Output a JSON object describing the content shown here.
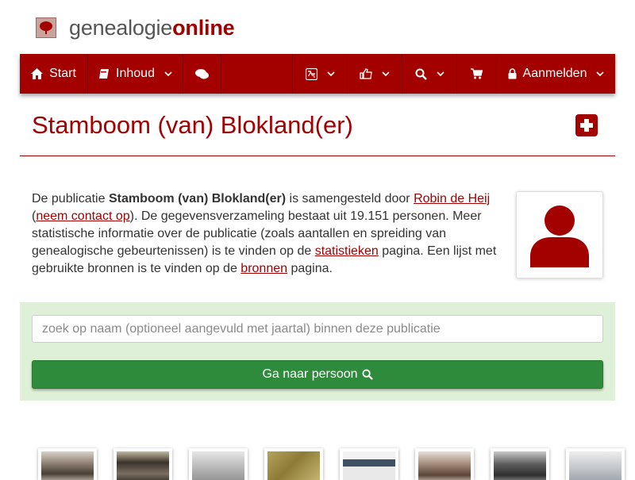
{
  "header": {
    "brand_part1": "genealogie",
    "brand_part2": "online"
  },
  "nav": {
    "start_label": "Start",
    "inhoud_label": "Inhoud",
    "login_label": "Aanmelden",
    "icons": [
      "home-icon",
      "book-icon",
      "chat-icon",
      "translate-icon",
      "thumbs-up-icon",
      "search-icon",
      "cart-icon",
      "lock-icon"
    ]
  },
  "page": {
    "title": "Stamboom (van) Blokland(er)"
  },
  "description": {
    "p1": "De publicatie ",
    "pub_name": "Stamboom (van) Blokland(er)",
    "p2": " is samengesteld door ",
    "author_link": "Robin de Heij",
    "p3": " (",
    "contact_link": "neem contact op",
    "p4": "). De gegevensverzameling bestaat uit 19.151 personen. Meer statistische informatie over de publicatie (zoals aantallen en spreiding van genealogische gebeurtenissen) is te vinden op de ",
    "stats_link": "statistieken",
    "p5": " pagina. Een lijst met gebruikte bronnen is te vinden op de ",
    "sources_link": "bronnen",
    "p6": " pagina."
  },
  "search": {
    "placeholder": "zoek op naam (optioneel aangevuld met jaartal) binnen deze publicatie",
    "button_label": "Ga naar persoon"
  },
  "colors": {
    "brand": "#a30000",
    "panel": "#dff0d8",
    "button": "#2e8b3b"
  }
}
